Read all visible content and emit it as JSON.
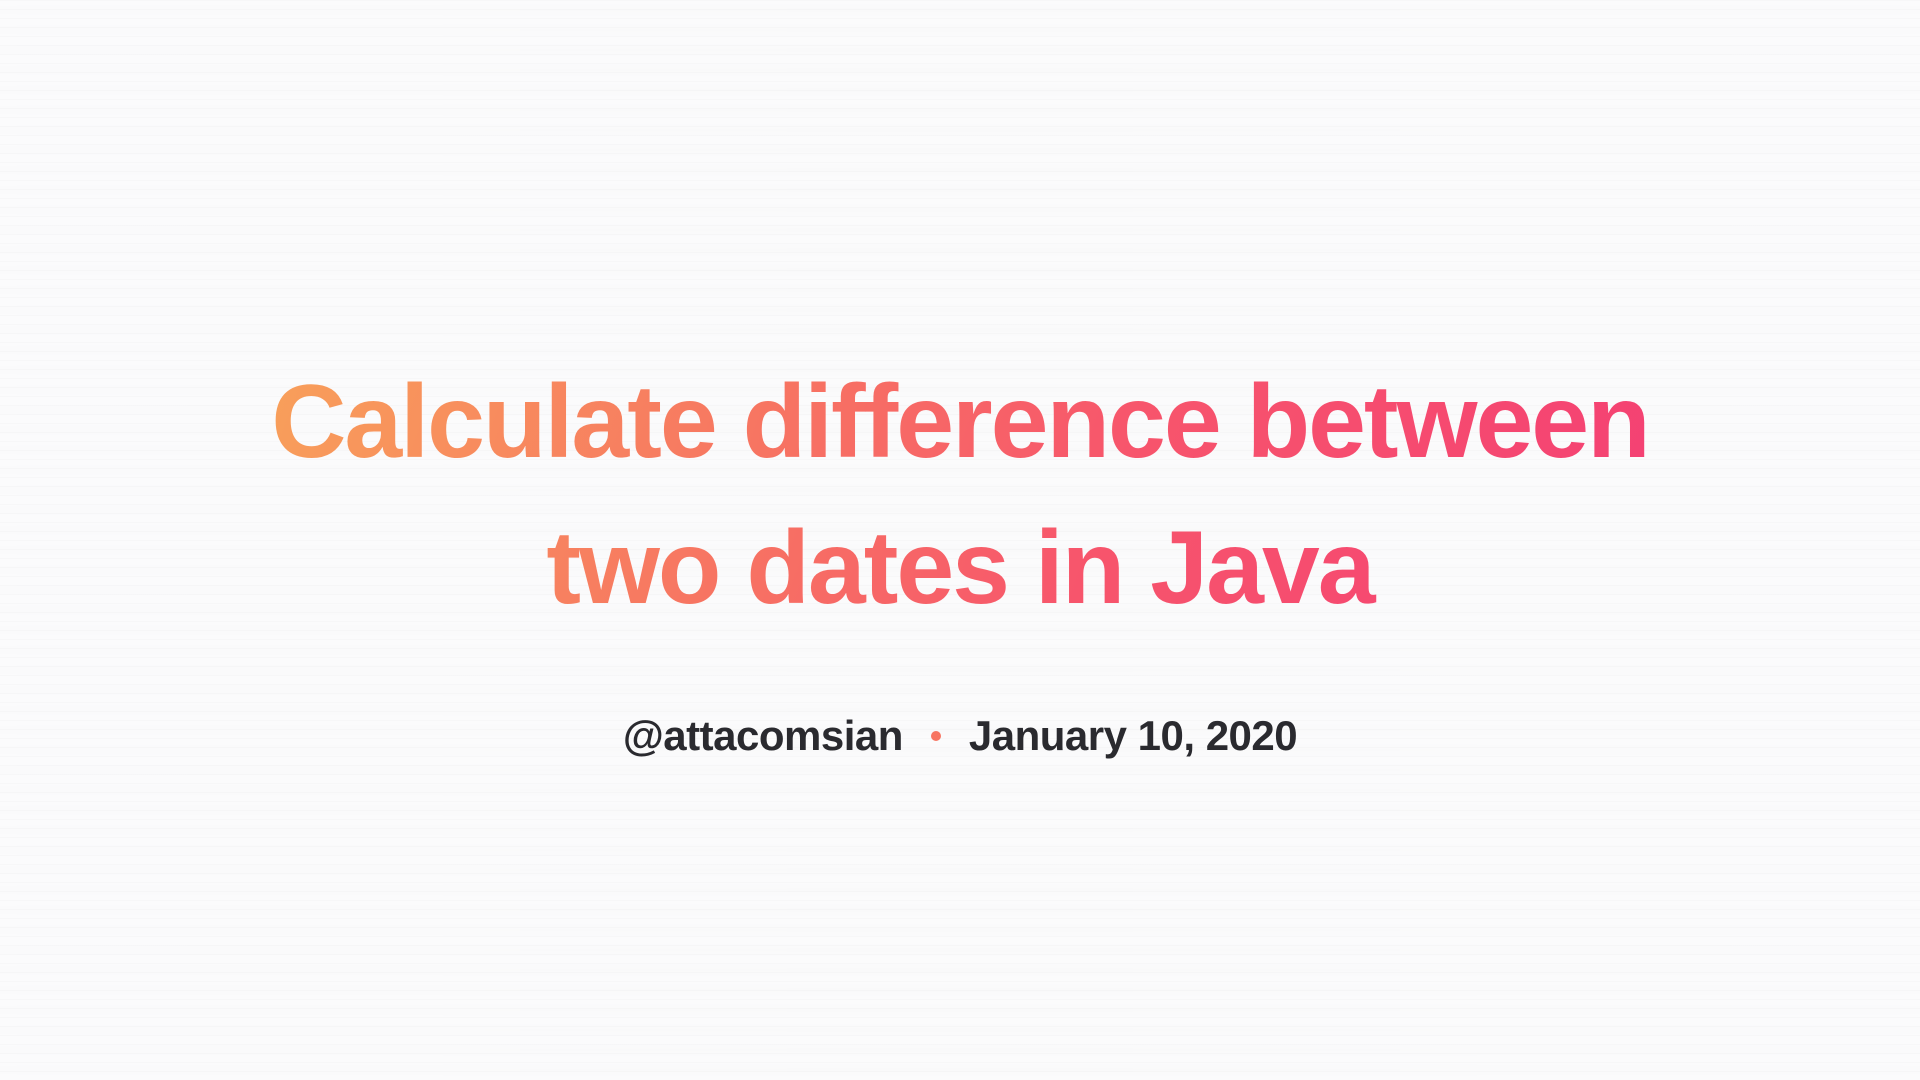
{
  "title": "Calculate difference between two dates in Java",
  "meta": {
    "author": "@attacomsian",
    "date": "January 10, 2020"
  }
}
